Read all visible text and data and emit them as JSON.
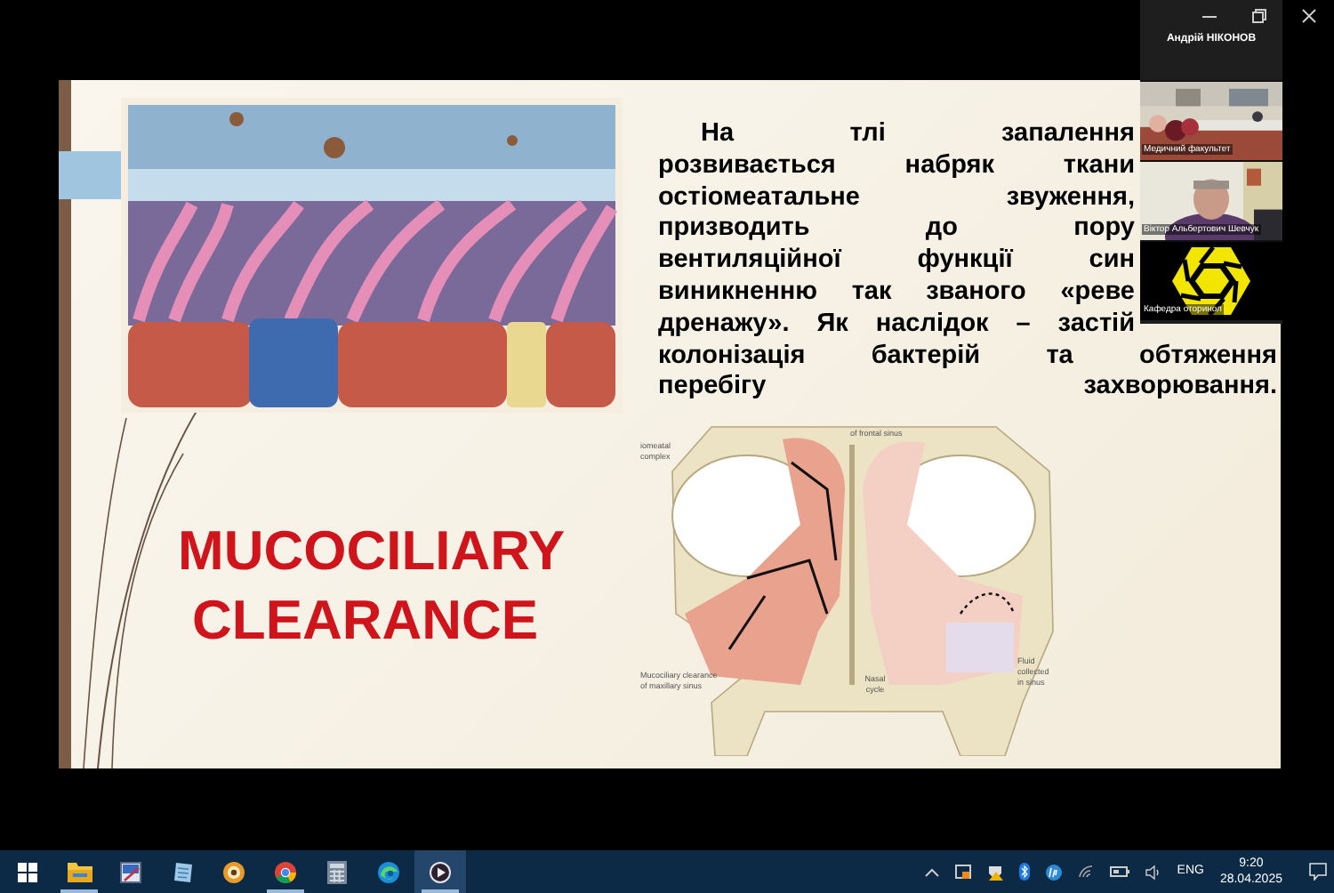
{
  "participant_panel": {
    "host_name": "Андрій НІКОНОВ",
    "tiles": [
      {
        "kind": "room",
        "label": "Медичний факультет"
      },
      {
        "kind": "person",
        "label": "Віктор Альбертович Шевчук"
      },
      {
        "kind": "logo",
        "label": "Кафедра оторинол"
      }
    ]
  },
  "slide": {
    "title_lines": [
      "MUCOCILIARY",
      "CLEARANCE"
    ],
    "paragraph": [
      "На тлі запалення",
      "розвивається набряк ткани",
      "остіомеатальне звуження,",
      "призводить до пору",
      "вентиляційної функції син",
      "виникненню так званого «реве",
      "дренажу». Як наслідок – застій",
      "колонізація бактерій та обтяження",
      "перебігу захворювання."
    ],
    "diagram_labels": [
      [
        "of frontal sinus"
      ],
      [
        "iomeatal",
        "complex"
      ],
      [
        "Mucociliary clearance",
        "of maxillary sinus"
      ],
      [
        "Nasal",
        "cycle"
      ],
      [
        "Fluid",
        "collected",
        "in sinus"
      ]
    ]
  },
  "taskbar": {
    "apps": [
      {
        "kind": "explorer",
        "running": true,
        "selected": false
      },
      {
        "kind": "tablet",
        "running": false,
        "selected": false
      },
      {
        "kind": "notes",
        "running": false,
        "selected": false
      },
      {
        "kind": "target",
        "running": false,
        "selected": false
      },
      {
        "kind": "chrome",
        "running": true,
        "selected": false
      },
      {
        "kind": "calculator",
        "running": false,
        "selected": false
      },
      {
        "kind": "edge",
        "running": false,
        "selected": false
      },
      {
        "kind": "player",
        "running": true,
        "selected": true
      }
    ],
    "language": "ENG",
    "time": "9:20",
    "date": "28.04.2025"
  }
}
